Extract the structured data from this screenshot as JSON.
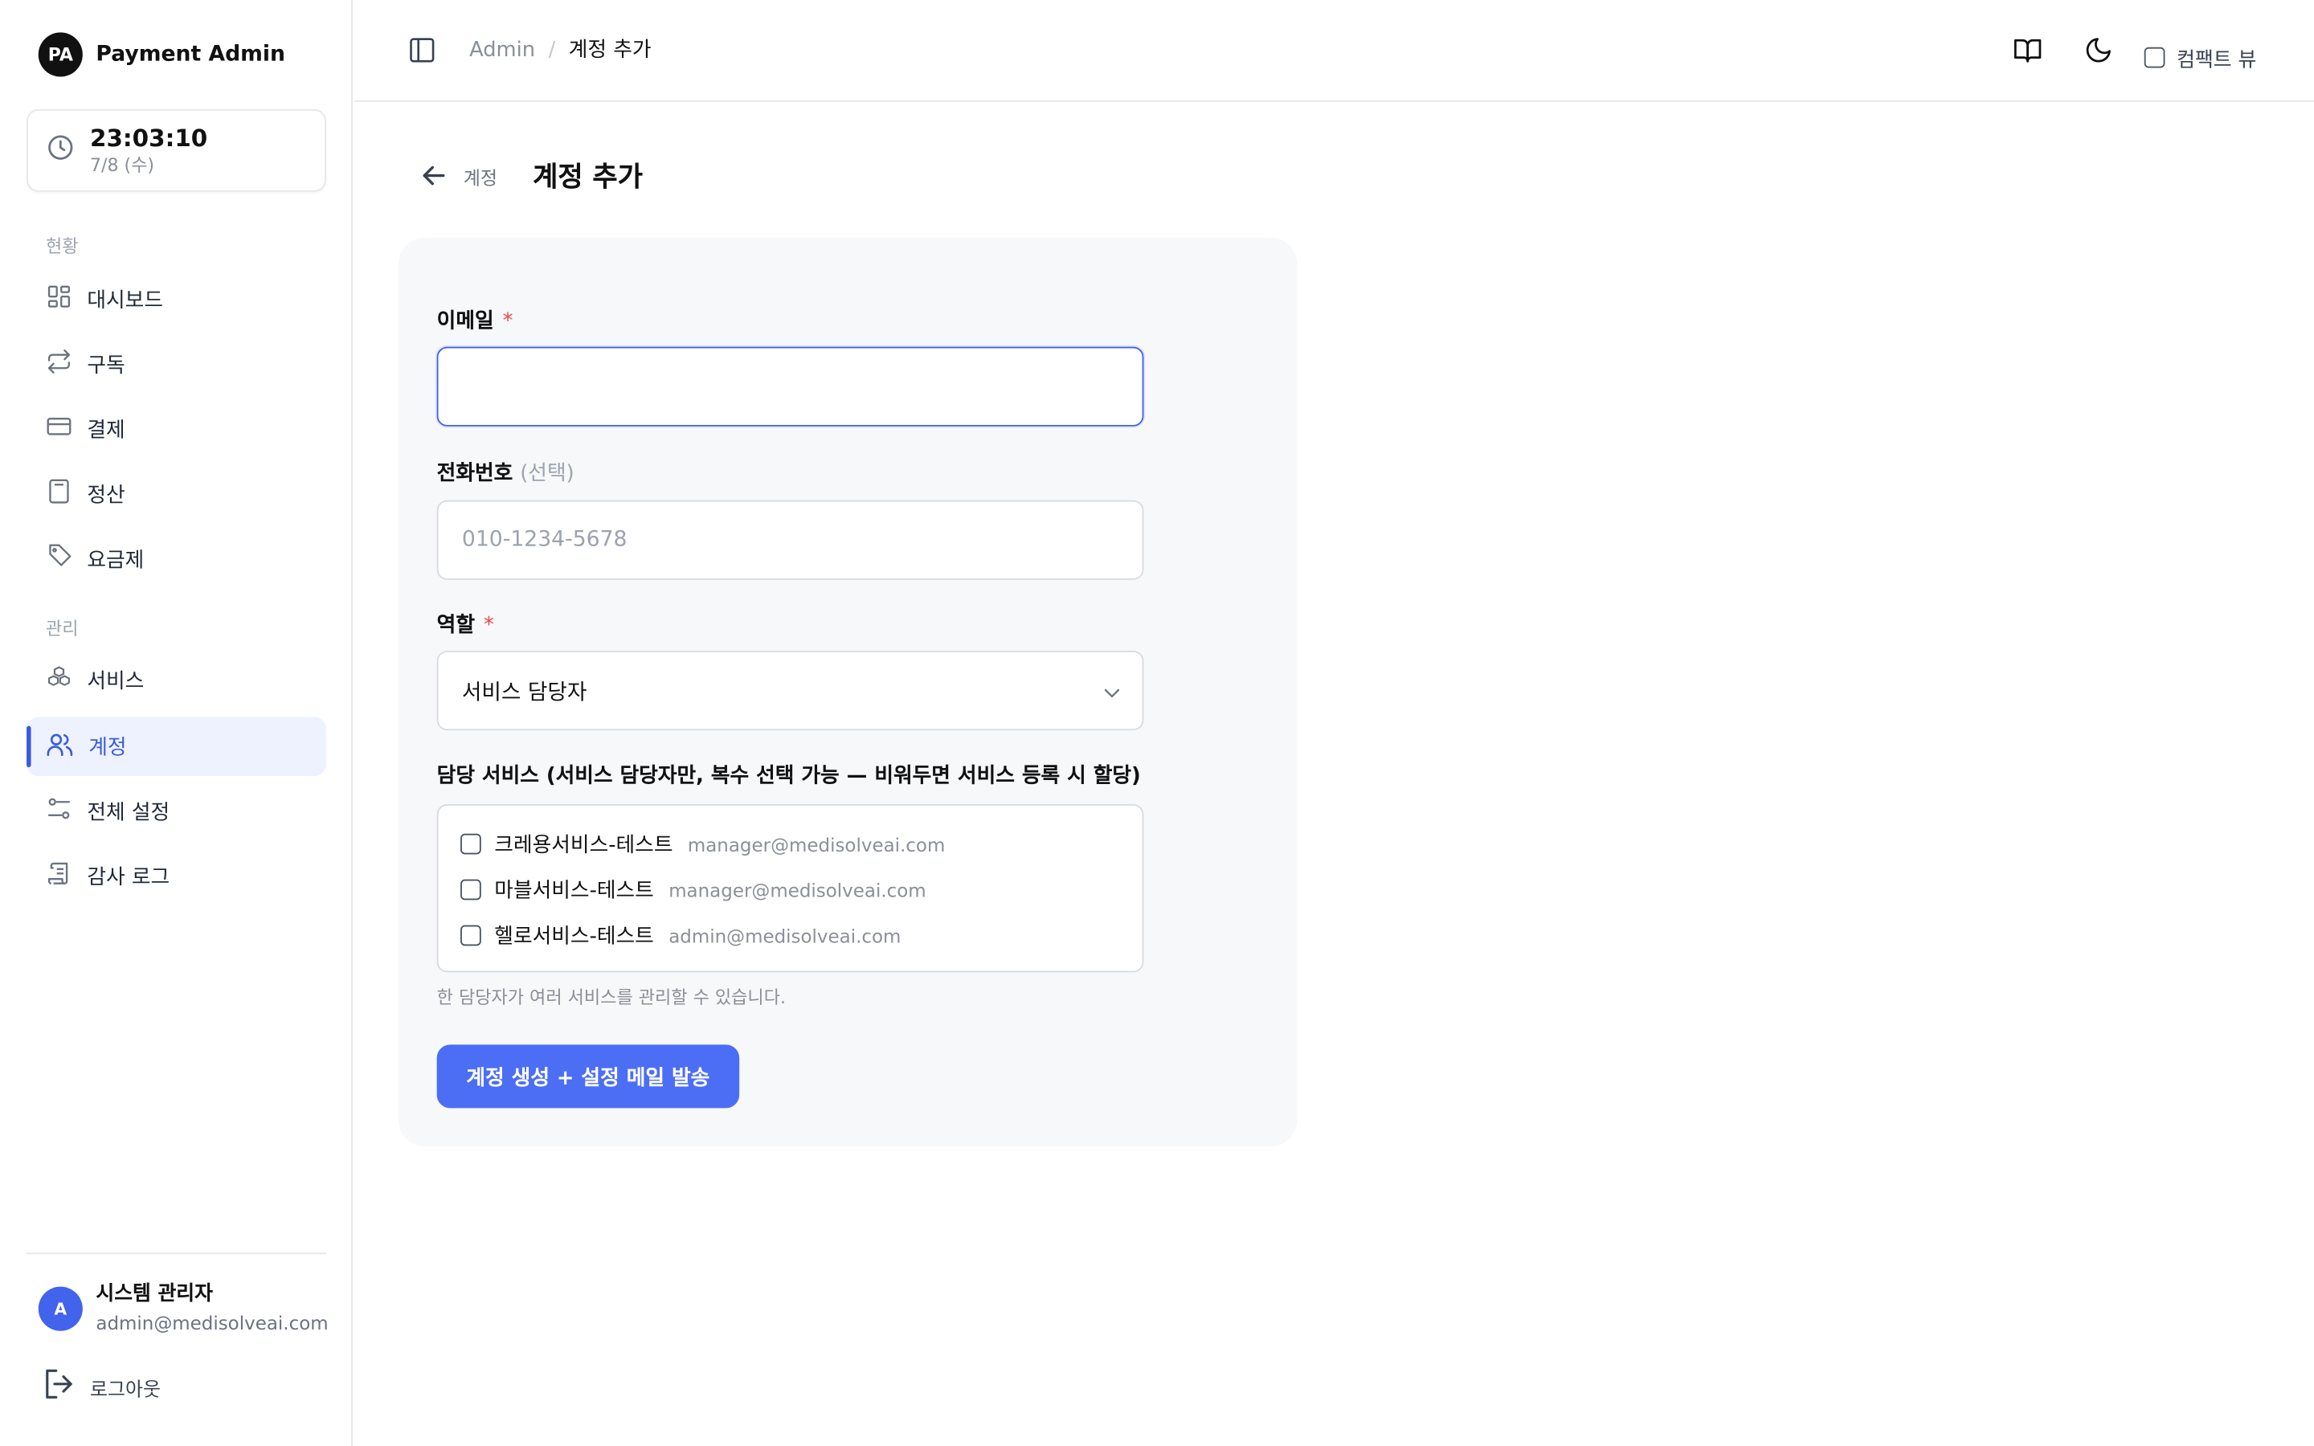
{
  "brand": {
    "initials": "PA",
    "name": "Payment Admin"
  },
  "clock": {
    "time": "23:03:10",
    "date": "7/8 (수)"
  },
  "sidebar": {
    "section_status": "현황",
    "section_manage": "관리",
    "items": [
      {
        "label": "대시보드",
        "icon": "dashboard-icon"
      },
      {
        "label": "구독",
        "icon": "repeat-icon"
      },
      {
        "label": "결제",
        "icon": "credit-card-icon"
      },
      {
        "label": "정산",
        "icon": "calculator-icon"
      },
      {
        "label": "요금제",
        "icon": "tag-icon"
      },
      {
        "label": "서비스",
        "icon": "boxes-icon"
      },
      {
        "label": "계정",
        "icon": "users-icon",
        "active": true
      },
      {
        "label": "전체 설정",
        "icon": "sliders-icon"
      },
      {
        "label": "감사 로그",
        "icon": "scroll-icon"
      }
    ]
  },
  "user": {
    "initial": "A",
    "name": "시스템 관리자",
    "email": "admin@medisolveai.com"
  },
  "logout_label": "로그아웃",
  "header": {
    "breadcrumb_root": "Admin",
    "breadcrumb_sep": "/",
    "breadcrumb_current": "계정 추가",
    "compact_view_label": "컴팩트 뷰"
  },
  "page": {
    "back_label": "계정",
    "title": "계정 추가"
  },
  "form": {
    "email_label": "이메일",
    "required_mark": "*",
    "email_value": "",
    "phone_label": "전화번호",
    "phone_optional": "(선택)",
    "phone_placeholder": "010-1234-5678",
    "role_label": "역할",
    "role_value": "서비스 담당자",
    "services_label": "담당 서비스 (서비스 담당자만, 복수 선택 가능 — 비워두면 서비스 등록 시 할당)",
    "services": [
      {
        "name": "크레용서비스-테스트",
        "email": "manager@medisolveai.com",
        "checked": false
      },
      {
        "name": "마블서비스-테스트",
        "email": "manager@medisolveai.com",
        "checked": false
      },
      {
        "name": "헬로서비스-테스트",
        "email": "admin@medisolveai.com",
        "checked": false
      }
    ],
    "helper_text": "한 담당자가 여러 서비스를 관리할 수 있습니다.",
    "submit_label": "계정 생성 + 설정 메일 발송"
  },
  "colors": {
    "accent": "#4c6ef5",
    "active_nav_bg": "#eef2ff",
    "required": "#ef4444"
  }
}
